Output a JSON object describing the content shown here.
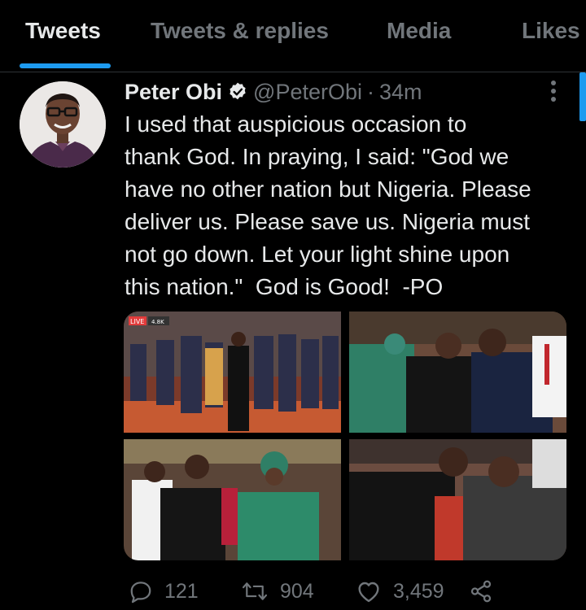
{
  "tabs": [
    {
      "label": "Tweets",
      "active": true
    },
    {
      "label": "Tweets & replies",
      "active": false
    },
    {
      "label": "Media",
      "active": false
    },
    {
      "label": "Likes",
      "active": false
    }
  ],
  "tweet": {
    "name": "Peter Obi",
    "handle": "@PeterObi",
    "separator": "·",
    "time": "34m",
    "text": "I used that auspicious occasion to\nthank God. In praying, I said: \"God we\nhave no other nation but Nigeria. Please\ndeliver us. Please save us. Nigeria must\nnot go down. Let your light shine upon\nthis nation.\"  God is Good!  -PO",
    "media_badge": "LIVE",
    "media_badge_extra": "4.8K",
    "stats": {
      "replies": "121",
      "retweets": "904",
      "likes": "3,459"
    }
  },
  "colors": {
    "accent": "#1d9bf0",
    "background": "#000000",
    "muted": "#71767b",
    "text": "#e7e9ea"
  },
  "icons": [
    "verified-badge-icon",
    "more-icon",
    "reply-icon",
    "retweet-icon",
    "like-icon",
    "share-icon"
  ]
}
